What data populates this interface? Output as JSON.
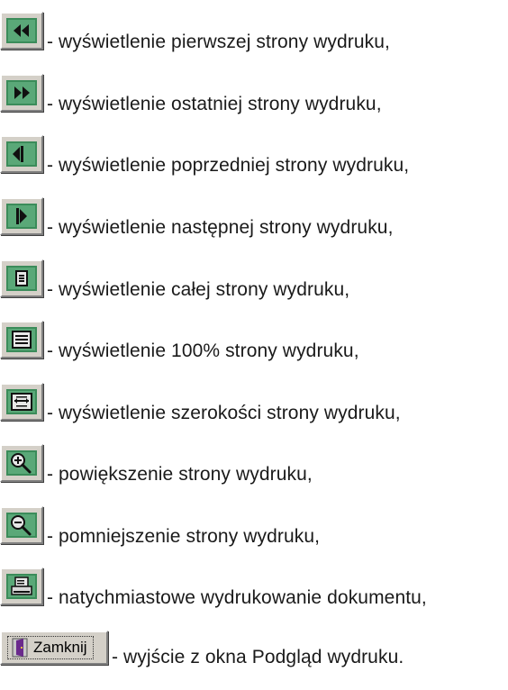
{
  "colors": {
    "button_face": "#d4d0c8",
    "icon_green": "#3b8c5a",
    "icon_dark": "#111111",
    "text": "#1a1a1a"
  },
  "items": [
    {
      "icon": "first-page-icon",
      "text": "- wyświetlenie pierwszej strony wydruku,"
    },
    {
      "icon": "last-page-icon",
      "text": "- wyświetlenie ostatniej strony wydruku,"
    },
    {
      "icon": "previous-page-icon",
      "text": "- wyświetlenie poprzedniej strony wydruku,"
    },
    {
      "icon": "next-page-icon",
      "text": "- wyświetlenie następnej strony wydruku,"
    },
    {
      "icon": "whole-page-icon",
      "text": "- wyświetlenie całej strony wydruku,"
    },
    {
      "icon": "full-size-page-icon",
      "text": "- wyświetlenie 100% strony wydruku,"
    },
    {
      "icon": "page-width-icon",
      "text": "- wyświetlenie szerokości strony wydruku,"
    },
    {
      "icon": "zoom-in-icon",
      "text": "- powiększenie strony wydruku,"
    },
    {
      "icon": "zoom-out-icon",
      "text": "- pomniejszenie strony wydruku,"
    },
    {
      "icon": "print-icon",
      "text": "- natychmiastowe wydrukowanie dokumentu,"
    },
    {
      "icon": "door-exit-icon",
      "button_label": "Zamknij",
      "text": "- wyjście z okna Podgląd wydruku."
    }
  ]
}
